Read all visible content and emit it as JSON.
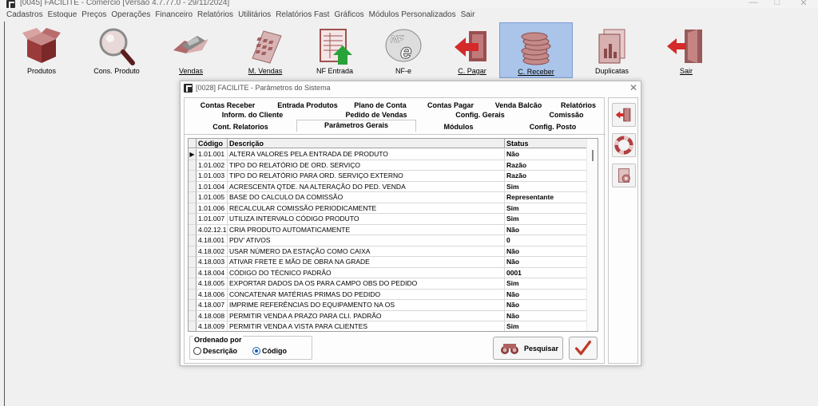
{
  "window": {
    "title": "[0045] FACILITE - Comércio [Versão 4.7.77.0 - 29/11/2024]",
    "minimize_glyph": "—",
    "maximize_glyph": "□",
    "close_glyph": "✕"
  },
  "menu": [
    "Cadastros",
    "Estoque",
    "Preços",
    "Operações",
    "Financeiro",
    "Relatórios",
    "Utilitários",
    "Relatórios Fast",
    "Gráficos",
    "Módulos Personalizados",
    "Sair"
  ],
  "toolbar": [
    {
      "label": "Produtos",
      "icon": "box-icon"
    },
    {
      "label": "Cons. Produto",
      "icon": "magnifier-icon"
    },
    {
      "label": "Vendas",
      "icon": "handshake-icon"
    },
    {
      "label": "M. Vendas",
      "icon": "calculator-icon"
    },
    {
      "label": "NF Entrada",
      "icon": "invoice-in-icon"
    },
    {
      "label": "NF-e",
      "icon": "nfe-icon"
    },
    {
      "label": "C. Pagar",
      "icon": "pay-icon"
    },
    {
      "label": "C. Receber",
      "icon": "coins-icon"
    },
    {
      "label": "Duplicatas",
      "icon": "documents-icon"
    },
    {
      "label": "Sair",
      "icon": "exit-door-icon"
    }
  ],
  "colors": {
    "active_tool": "#aac4ea",
    "accent": "#1a5fb4",
    "ok_check": "#c0392b"
  },
  "dialog": {
    "title": "[0028] FACILITE - Parâmetros do Sistema",
    "close_glyph": "✕",
    "tabs_row1": [
      "Contas Receber",
      "Entrada Produtos",
      "Plano de Conta",
      "Contas Pagar",
      "Venda Balcão",
      "Relatórios"
    ],
    "tabs_row2": [
      "Inform. do Cliente",
      "Pedido de Vendas",
      "Config. Gerais",
      "Comissão"
    ],
    "tabs_row3": [
      "Cont. Relatorios",
      "Parâmetros Gerais",
      "Módulos",
      "Config. Posto"
    ],
    "active_tab": "Parâmetros Gerais",
    "grid": {
      "headers": [
        "Código",
        "Descrição",
        "Status"
      ],
      "rows": [
        {
          "code": "1.01.001",
          "desc": "ALTERA VALORES PELA ENTRADA DE PRODUTO",
          "status": "Não"
        },
        {
          "code": "1.01.002",
          "desc": "TIPO DO RELATÓRIO DE ORD. SERVIÇO",
          "status": "Razão"
        },
        {
          "code": "1.01.003",
          "desc": "TIPO DO RELATÓRIO PARA ORD. SERVIÇO EXTERNO",
          "status": "Razão"
        },
        {
          "code": "1.01.004",
          "desc": "ACRESCENTA QTDE. NA ALTERAÇÃO DO PED. VENDA",
          "status": "Sim"
        },
        {
          "code": "1.01.005",
          "desc": "BASE DO CALCULO DA COMISSÃO",
          "status": "Representante"
        },
        {
          "code": "1.01.006",
          "desc": "RECALCULAR COMISSÃO PERIODICAMENTE",
          "status": "Sim"
        },
        {
          "code": "1.01.007",
          "desc": "UTILIZA INTERVALO CÓDIGO PRODUTO",
          "status": "Sim"
        },
        {
          "code": "4.02.12.1",
          "desc": "CRIA PRODUTO AUTOMATICAMENTE",
          "status": "Não"
        },
        {
          "code": "4.18.001",
          "desc": "PDV' ATIVOS",
          "status": "0"
        },
        {
          "code": "4.18.002",
          "desc": "USAR NÚMERO DA ESTAÇÃO COMO CAIXA",
          "status": "Não"
        },
        {
          "code": "4.18.003",
          "desc": "ATIVAR FRETE E MÃO DE OBRA NA GRADE",
          "status": "Não"
        },
        {
          "code": "4.18.004",
          "desc": "CÓDIGO DO TÉCNICO PADRÃO",
          "status": "0001"
        },
        {
          "code": "4.18.005",
          "desc": "EXPORTAR DADOS DA OS PARA CAMPO OBS DO PEDIDO",
          "status": "Sim"
        },
        {
          "code": "4.18.006",
          "desc": "CONCATENAR MATÉRIAS PRIMAS DO PEDIDO",
          "status": "Não"
        },
        {
          "code": "4.18.007",
          "desc": "IMPRIME REFERÊNCIAS DO EQUIPAMENTO NA OS",
          "status": "Não"
        },
        {
          "code": "4.18.008",
          "desc": "PERMITIR VENDA A PRAZO PARA CLI. PADRÃO",
          "status": "Não"
        },
        {
          "code": "4.18.009",
          "desc": "PERMITIR VENDA A VISTA PARA CLIENTES",
          "status": "Sim"
        }
      ],
      "selected_row": 0,
      "row_pointer": "▶"
    },
    "order": {
      "title": "Ordenado por",
      "options": [
        "Descrição",
        "Código"
      ],
      "selected": "Código"
    },
    "search_button": "Pesquisar",
    "side_buttons": [
      "exit-icon",
      "lifebuoy-icon",
      "gear-doc-icon"
    ]
  }
}
